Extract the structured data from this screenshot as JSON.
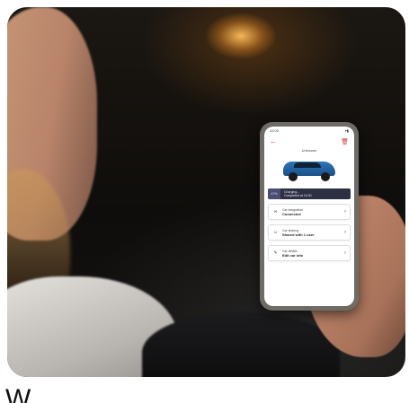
{
  "phone": {
    "status_time": "12:00",
    "car_name": "Unknown",
    "charging": {
      "percent": "47%",
      "label": "Charging...",
      "sublabel": "Completed at 16:30"
    },
    "cards": [
      {
        "label": "Car integration",
        "value": "Connected",
        "icon": "link-icon"
      },
      {
        "label": "Car sharing",
        "value": "Shared with 1 user",
        "icon": "users-icon"
      },
      {
        "label": "Car details",
        "value": "Edit car info",
        "icon": "edit-icon"
      }
    ]
  },
  "caption": {
    "text": "W"
  },
  "colors": {
    "accent": "#d23b3b",
    "car": "#2e76b8",
    "charging_bar": "#2d2f43"
  }
}
